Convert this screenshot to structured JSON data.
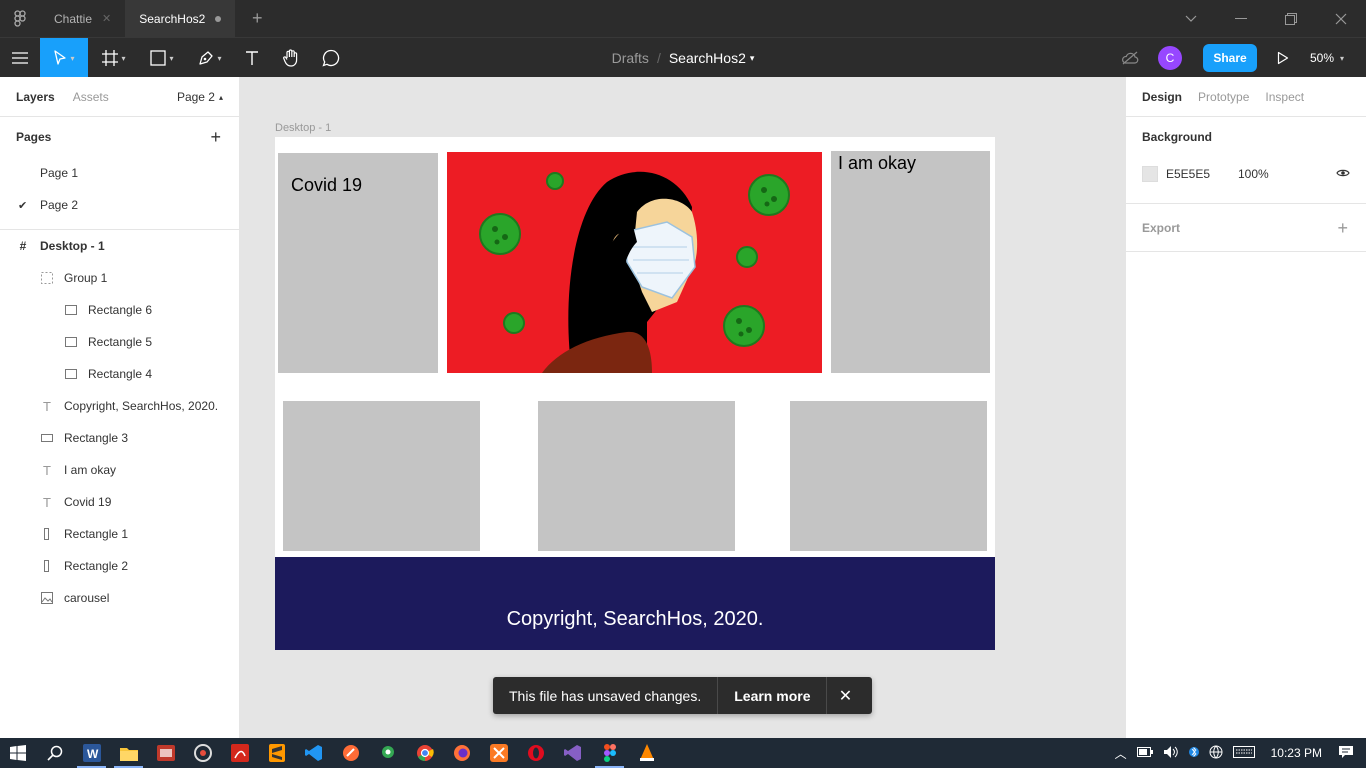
{
  "titlebar": {
    "tabs": [
      {
        "label": "Chattie",
        "active": false
      },
      {
        "label": "SearchHos2",
        "active": true
      }
    ]
  },
  "toolbar": {
    "breadcrumb": {
      "drafts": "Drafts",
      "separator": "/",
      "file": "SearchHos2"
    },
    "avatar_initial": "C",
    "share_label": "Share",
    "zoom": "50%",
    "accent": "#18a0fb"
  },
  "left_panel": {
    "tabs": {
      "layers": "Layers",
      "assets": "Assets"
    },
    "current_page": "Page 2",
    "pages_title": "Pages",
    "pages": [
      {
        "label": "Page 1",
        "selected": false
      },
      {
        "label": "Page 2",
        "selected": true
      }
    ],
    "layers": [
      {
        "label": "Desktop - 1",
        "icon": "frame-icon",
        "level": 0
      },
      {
        "label": "Group 1",
        "icon": "group-icon",
        "level": 1
      },
      {
        "label": "Rectangle 6",
        "icon": "rectangle-icon",
        "level": 2
      },
      {
        "label": "Rectangle 5",
        "icon": "rectangle-icon",
        "level": 2
      },
      {
        "label": "Rectangle 4",
        "icon": "rectangle-icon",
        "level": 2
      },
      {
        "label": "Copyright, SearchHos, 2020.",
        "icon": "text-icon",
        "level": 1
      },
      {
        "label": "Rectangle 3",
        "icon": "rectangle-icon",
        "level": 1
      },
      {
        "label": "I am okay",
        "icon": "text-icon",
        "level": 1
      },
      {
        "label": "Covid 19",
        "icon": "text-icon",
        "level": 1
      },
      {
        "label": "Rectangle 1",
        "icon": "rectangle-icon",
        "level": 1
      },
      {
        "label": "Rectangle 2",
        "icon": "rectangle-icon",
        "level": 1
      },
      {
        "label": "carousel",
        "icon": "image-icon",
        "level": 1
      }
    ]
  },
  "canvas": {
    "frame_label": "Desktop - 1",
    "covid_text": "Covid 19",
    "okay_text": "I am okay",
    "copyright": "Copyright, SearchHos, 2020.",
    "footer_color": "#1c1a5c",
    "hero_color": "#ed1c24"
  },
  "toast": {
    "message": "This file has unsaved changes.",
    "learn_more": "Learn more"
  },
  "help_label": "?",
  "right_panel": {
    "tabs": {
      "design": "Design",
      "prototype": "Prototype",
      "inspect": "Inspect"
    },
    "background_title": "Background",
    "bg_hex": "E5E5E5",
    "bg_opacity": "100%",
    "export_title": "Export"
  },
  "taskbar": {
    "time": "10:23 PM"
  }
}
